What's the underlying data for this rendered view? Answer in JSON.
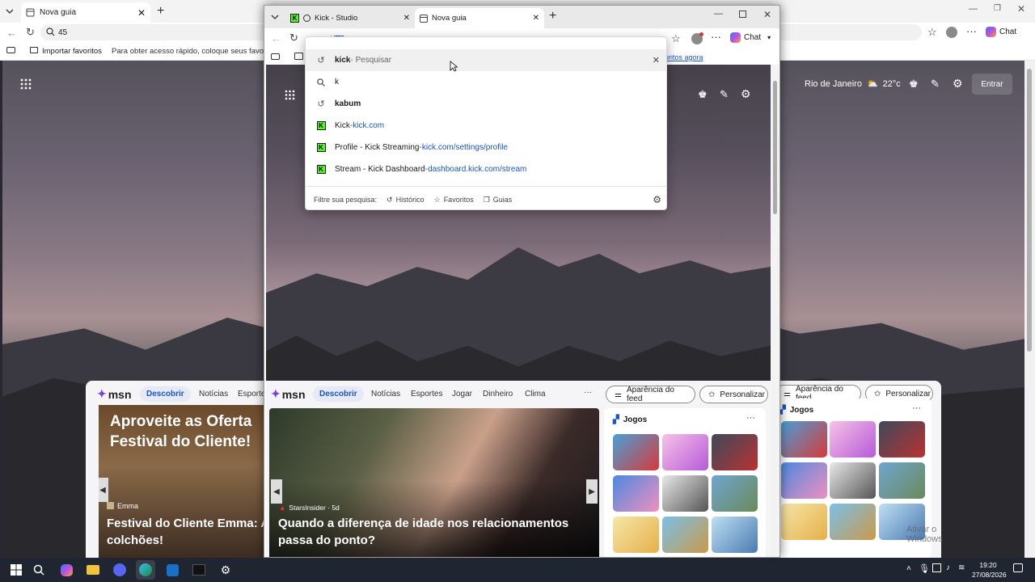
{
  "background_browser": {
    "tab_title": "Nova guia",
    "address_value": "45",
    "favorites_bar": {
      "import_label": "Importar favoritos",
      "hint_text": "Para obter acesso rápido, coloque seus favorit"
    },
    "chat_label": "Chat",
    "weather": {
      "city": "Rio de Janeiro",
      "temp": "22°c"
    },
    "signin_label": "Entrar",
    "feed": {
      "logo": "msn",
      "nav": [
        "Descobrir",
        "Notícias",
        "Esporte"
      ],
      "appearance_label": "Aparência do feed",
      "personalize_label": "Personalizar",
      "games_title": "Jogos",
      "promo_title_1": "Aproveite as Oferta",
      "promo_title_2": "Festival do Cliente!",
      "story_source": "Emma",
      "story_headline": "Festival do Cliente Emma: A colchões!"
    },
    "watermark": "Ativar o Windows"
  },
  "foreground_browser": {
    "tabs": [
      {
        "title": "Kick - Studio"
      },
      {
        "title": "Nova guia"
      }
    ],
    "address_value_typed": "k",
    "address_value_selected": "ick",
    "chat_label": "Chat",
    "favorites_link": "oritos agora",
    "suggestions": [
      {
        "icon": "history-icon",
        "bold": "kick",
        "rest": " - Pesquisar",
        "url": ""
      },
      {
        "icon": "search-icon",
        "bold": "k",
        "rest": "",
        "url": ""
      },
      {
        "icon": "history-icon",
        "bold": "kabum",
        "rest": "",
        "url": ""
      },
      {
        "icon": "kick-icon",
        "bold": "Kick",
        "rest": "",
        "url_pre": " - ",
        "url": "kick.com"
      },
      {
        "icon": "kick-icon",
        "bold": "Profile - Kick Streaming",
        "rest": "",
        "url_pre": " - ",
        "url": "kick.com/settings/profile"
      },
      {
        "icon": "kick-icon",
        "bold": "Stream - Kick Dashboard",
        "rest": "",
        "url_pre": " - ",
        "url": "dashboard.kick.com/stream"
      }
    ],
    "filter": {
      "label": "Filtre sua pesquisa:",
      "history": "Histórico",
      "favorites": "Favoritos",
      "tabs": "Guias"
    },
    "feed": {
      "logo": "msn",
      "nav": [
        "Descobrir",
        "Notícias",
        "Esportes",
        "Jogar",
        "Dinheiro",
        "Clima"
      ],
      "more": "···",
      "appearance_label": "Aparência do feed",
      "personalize_label": "Personalizar",
      "games_title": "Jogos",
      "story_source": "StarsInsider · 5d",
      "story_headline": "Quando a diferença de idade nos relacionamentos passa do ponto?"
    }
  },
  "taskbar": {
    "time": "19:20",
    "date": "27/08/2026"
  },
  "colors": {
    "accent": "#1b54c5",
    "kick_green": "#53fc18",
    "taskbar": "#1f2531"
  }
}
